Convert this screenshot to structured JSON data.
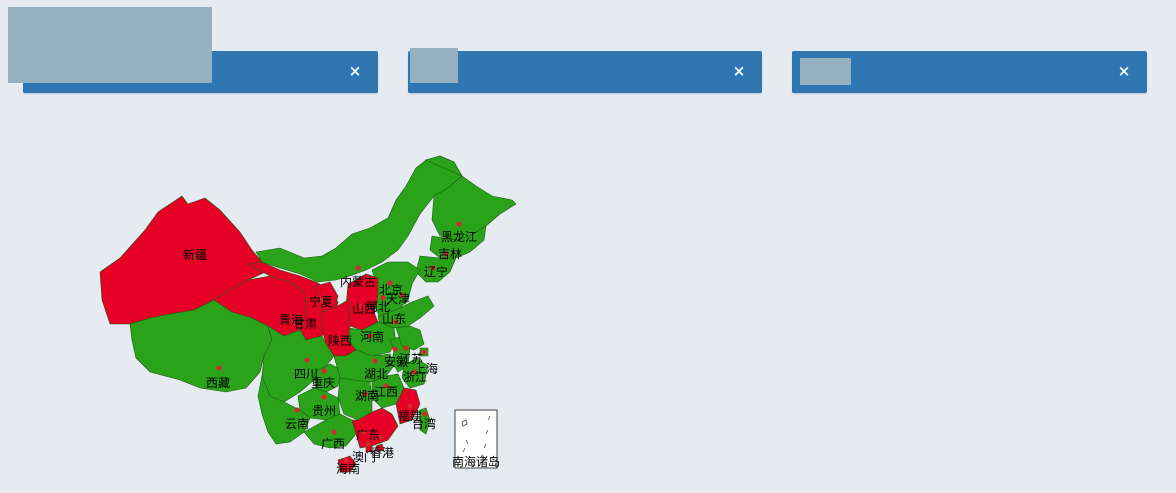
{
  "panels": [
    {
      "close_label": "×"
    },
    {
      "close_label": "×"
    },
    {
      "close_label": "×"
    }
  ],
  "colors": {
    "background": "#e6ebf2",
    "panel": "#2e77b2",
    "placeholder": "#95b1bf",
    "region_green": "#2aa31a",
    "region_red": "#e60026",
    "marker": "#d42a2a"
  },
  "map": {
    "regions": [
      {
        "name": "新疆",
        "status": "red"
      },
      {
        "name": "西藏",
        "status": "green"
      },
      {
        "name": "青海",
        "status": "red"
      },
      {
        "name": "甘肃",
        "status": "red"
      },
      {
        "name": "宁夏",
        "status": "red"
      },
      {
        "name": "内蒙古",
        "status": "green"
      },
      {
        "name": "黑龙江",
        "status": "green"
      },
      {
        "name": "吉林",
        "status": "green"
      },
      {
        "name": "辽宁",
        "status": "green"
      },
      {
        "name": "北京",
        "status": "green"
      },
      {
        "name": "天津",
        "status": "green"
      },
      {
        "name": "河北",
        "status": "green"
      },
      {
        "name": "山西",
        "status": "red"
      },
      {
        "name": "山东",
        "status": "green"
      },
      {
        "name": "河南",
        "status": "green"
      },
      {
        "name": "陕西",
        "status": "red"
      },
      {
        "name": "四川",
        "status": "green"
      },
      {
        "name": "重庆",
        "status": "green"
      },
      {
        "name": "湖北",
        "status": "green"
      },
      {
        "name": "安徽",
        "status": "green"
      },
      {
        "name": "江苏",
        "status": "green"
      },
      {
        "name": "上海",
        "status": "green"
      },
      {
        "name": "浙江",
        "status": "green"
      },
      {
        "name": "江西",
        "status": "green"
      },
      {
        "name": "湖南",
        "status": "green"
      },
      {
        "name": "贵州",
        "status": "green"
      },
      {
        "name": "云南",
        "status": "green"
      },
      {
        "name": "广西",
        "status": "green"
      },
      {
        "name": "广东",
        "status": "red"
      },
      {
        "name": "福建",
        "status": "red"
      },
      {
        "name": "台湾",
        "status": "green"
      },
      {
        "name": "香港",
        "status": "red"
      },
      {
        "name": "澳门",
        "status": "red"
      },
      {
        "name": "海南",
        "status": "red"
      }
    ],
    "inset_label": "南海诸岛"
  }
}
